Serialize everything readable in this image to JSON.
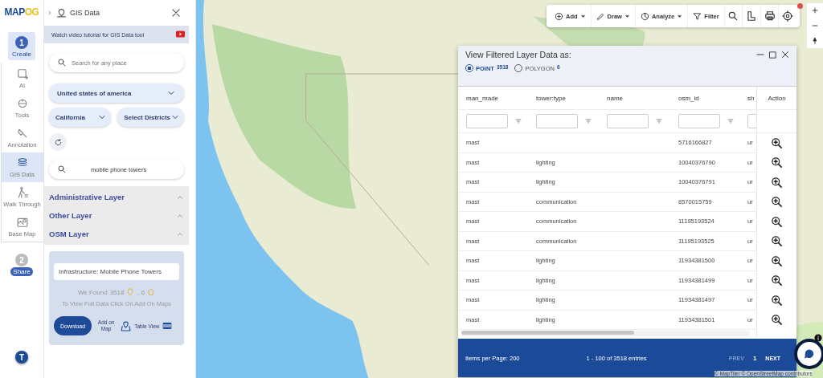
{
  "logo": {
    "text": "MAP",
    "accent": "OG"
  },
  "rail": {
    "steps": [
      {
        "number": "1",
        "label": "Create",
        "selected": true
      }
    ],
    "items": [
      {
        "label": "AI",
        "selected": false
      },
      {
        "label": "Tools",
        "selected": false
      },
      {
        "label": "Annotation",
        "selected": false
      },
      {
        "label": "GIS Data",
        "selected": true
      },
      {
        "label": "Walk Through",
        "selected": false
      },
      {
        "label": "Base Map",
        "selected": false
      }
    ],
    "share_step": {
      "number": "2",
      "label": "Share"
    },
    "avatar": {
      "initial": "T"
    }
  },
  "panel": {
    "title": "GIS Data",
    "tutorial": "Watch video tutorial for GIS Data tool",
    "search": {
      "placeholder": "Search for any place"
    },
    "country": "United states of america",
    "state": "California",
    "district": "Select Districts",
    "layer_search": "mobile phone towers",
    "layers": [
      {
        "label": "Administrative Layer"
      },
      {
        "label": "Other Layer"
      },
      {
        "label": "OSM Layer"
      }
    ],
    "result": {
      "title": "Infrastructure: Mobile Phone Towers",
      "found_label": "We Found",
      "point_count": "3518",
      "separator": ",",
      "polygon_count": "6",
      "hint": "To View Full Data Click On Add On Maps",
      "download": "Download",
      "add_on_map": "Add on Map",
      "table_view": "Table View"
    }
  },
  "toolbar": {
    "buttons": [
      {
        "kind": "menu",
        "label": "Add"
      },
      {
        "kind": "menu",
        "label": "Draw"
      },
      {
        "kind": "menu",
        "label": "Analyze"
      },
      {
        "kind": "plain",
        "label": "Filter"
      }
    ]
  },
  "dialog": {
    "title": "View Filtered Layer Data as:",
    "options": [
      {
        "label": "POINT",
        "count": "3518",
        "selected": true
      },
      {
        "label": "POLYGON",
        "count": "6",
        "selected": false
      }
    ],
    "table": {
      "columns": [
        "man_made",
        "tower:type",
        "name",
        "osm_id",
        "sh"
      ],
      "action_label": "Action",
      "rows": [
        {
          "man_made": "mast",
          "osm_id": "5716166827",
          "column_5": "ur"
        },
        {
          "man_made": "mast",
          "tower_type": "lighting",
          "osm_id": "10040376790",
          "column_5": "ur"
        },
        {
          "man_made": "mast",
          "tower_type": "lighting",
          "osm_id": "10040376791",
          "column_5": "ur"
        },
        {
          "man_made": "mast",
          "tower_type": "communication",
          "osm_id": "8570015759",
          "column_5": "ur"
        },
        {
          "man_made": "mast",
          "tower_type": "communication",
          "osm_id": "11195193524",
          "column_5": "ur"
        },
        {
          "man_made": "mast",
          "tower_type": "communication",
          "osm_id": "11195193525",
          "column_5": "ur"
        },
        {
          "man_made": "mast",
          "tower_type": "lighting",
          "osm_id": "11934381500",
          "column_5": "ur"
        },
        {
          "man_made": "mast",
          "tower_type": "lighting",
          "osm_id": "11934381499",
          "column_5": "ur"
        },
        {
          "man_made": "mast",
          "tower_type": "lighting",
          "osm_id": "11934381497",
          "column_5": "ur"
        },
        {
          "man_made": "mast",
          "tower_type": "lighting",
          "osm_id": "11934381501",
          "column_5": "ur"
        }
      ]
    },
    "footer": {
      "items_per_page": "Items per Page: 200",
      "range": "1 - 100 of 3518 entries",
      "prev": "PREV",
      "page": "1",
      "next": "NEXT"
    }
  },
  "attribution": "© MapTiler © OpenStreetMap contributors"
}
